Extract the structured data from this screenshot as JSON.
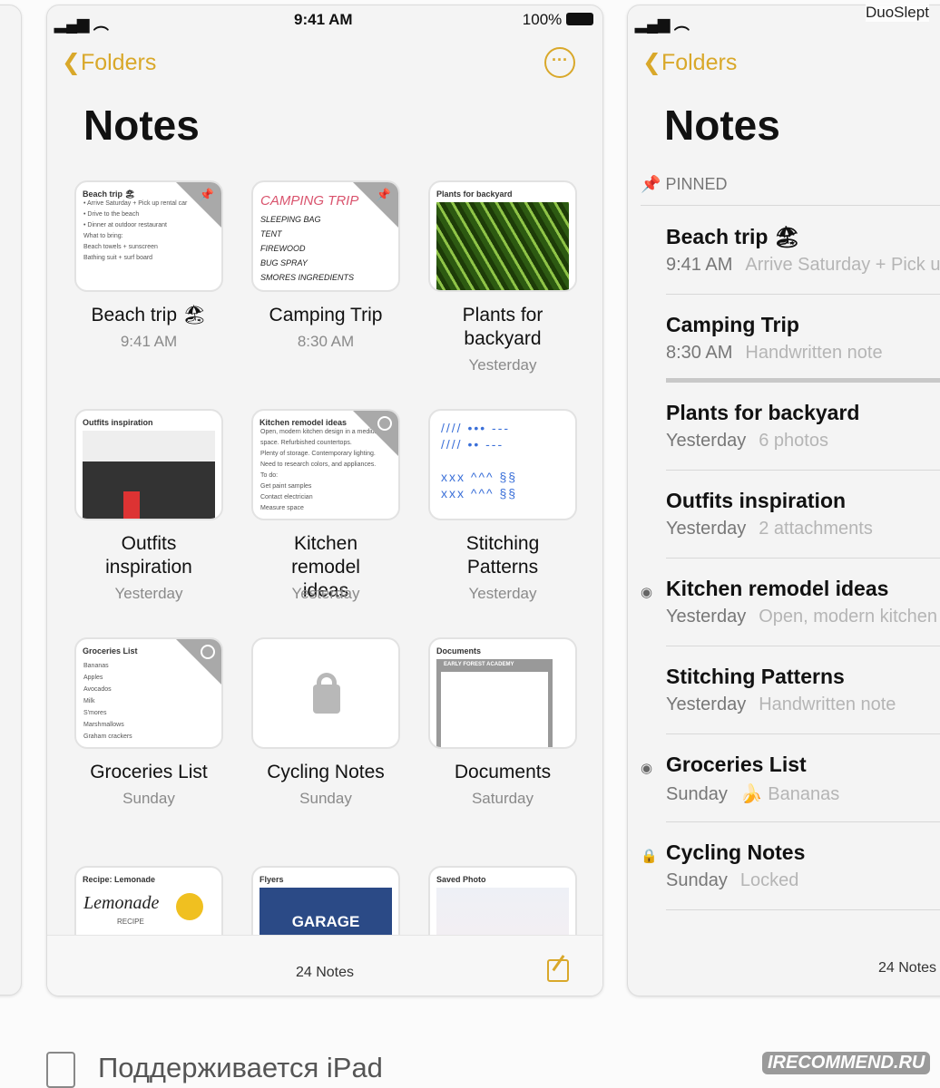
{
  "status": {
    "time": "9:41 AM",
    "battery": "100%"
  },
  "nav": {
    "back_label": "Folders",
    "title": "Notes",
    "more_icon": "ellipsis-circle-icon"
  },
  "accent": "#d9a82a",
  "grid": [
    {
      "title": "Beach trip 🏖",
      "date": "9:41 AM",
      "thumb_title": "Beach trip 🏖",
      "pinned": true,
      "lines": [
        "• Arrive Saturday + Pick up rental car",
        "• Drive to the beach",
        "• Dinner at outdoor restaurant",
        "What to bring:",
        "Beach towels + sunscreen",
        "Bathing suit + surf board"
      ]
    },
    {
      "title": "Camping Trip",
      "date": "8:30 AM",
      "pinned": true,
      "lines": [
        "CAMPING TRIP",
        "SLEEPING BAG",
        "TENT",
        "FIREWOOD",
        "BUG SPRAY",
        "SMORES INGREDIENTS"
      ]
    },
    {
      "title": "Plants for backyard",
      "date": "Yesterday",
      "thumb_title": "Plants for backyard"
    },
    {
      "title": "Outfits inspiration",
      "date": "Yesterday",
      "thumb_title": "Outfits inspiration"
    },
    {
      "title": "Kitchen remodel ideas",
      "date": "Yesterday",
      "thumb_title": "Kitchen remodel ideas",
      "shared": true,
      "lines": [
        "Open, modern kitchen design in a medium",
        "space. Refurbished countertops.",
        "Plenty of storage. Contemporary lighting.",
        "Need to research colors, and appliances.",
        "To do:",
        "Get paint samples",
        "Contact electrician",
        "Measure space"
      ]
    },
    {
      "title": "Stitching Patterns",
      "date": "Yesterday"
    },
    {
      "title": "Groceries List",
      "date": "Sunday",
      "thumb_title": "Groceries List",
      "shared": true,
      "lines": [
        "Bananas",
        "Apples",
        "Avocados",
        "Milk",
        "S'mores",
        "Marshmallows",
        "Graham crackers"
      ]
    },
    {
      "title": "Cycling Notes",
      "date": "Sunday",
      "locked": true
    },
    {
      "title": "Documents",
      "date": "Saturday",
      "thumb_title": "Documents",
      "lines": [
        "EARLY FOREST ACADEMY"
      ]
    },
    {
      "thumb_title": "Recipe: Lemonade",
      "lines": [
        "Lemonade",
        "RECIPE"
      ]
    },
    {
      "thumb_title": "Flyers",
      "lines": [
        "GARAGE"
      ]
    },
    {
      "thumb_title": "Saved Photo"
    }
  ],
  "footer": {
    "count": "24 Notes"
  },
  "list": {
    "pinned_label": "PINNED",
    "items": [
      {
        "title": "Beach trip 🏖",
        "date": "9:41 AM",
        "preview": "Arrive Saturday + Pick up"
      },
      {
        "title": "Camping Trip",
        "date": "8:30 AM",
        "preview": "Handwritten note"
      },
      {
        "title": "Plants for backyard",
        "date": "Yesterday",
        "preview": "6 photos"
      },
      {
        "title": "Outfits inspiration",
        "date": "Yesterday",
        "preview": "2 attachments"
      },
      {
        "title": "Kitchen remodel ideas",
        "date": "Yesterday",
        "preview": "Open, modern kitchen",
        "icon": "shared-person-icon"
      },
      {
        "title": "Stitching Patterns",
        "date": "Yesterday",
        "preview": "Handwritten note"
      },
      {
        "title": "Groceries List",
        "date": "Sunday",
        "preview": "🍌 Bananas",
        "icon": "shared-person-icon"
      },
      {
        "title": "Cycling Notes",
        "date": "Sunday",
        "preview": "Locked",
        "icon": "lock-icon"
      }
    ]
  },
  "caption": "Поддерживается iPad",
  "watermarks": [
    "DuoSlept",
    "IRECOMMEND.RU"
  ]
}
